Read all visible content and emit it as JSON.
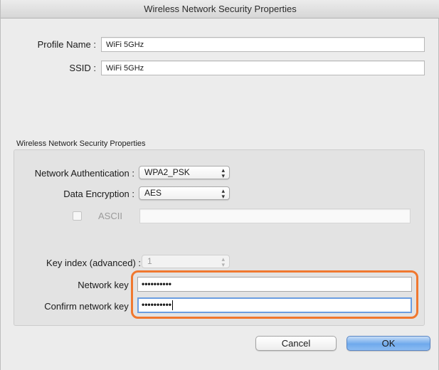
{
  "window": {
    "title": "Wireless Network Security Properties"
  },
  "profile": {
    "name_label": "Profile Name :",
    "name_value": "WiFi 5GHz",
    "ssid_label": "SSID :",
    "ssid_value": "WiFi 5GHz"
  },
  "security": {
    "group_title": "Wireless Network Security Properties",
    "auth_label": "Network Authentication :",
    "auth_value": "WPA2_PSK",
    "encryption_label": "Data Encryption :",
    "encryption_value": "AES",
    "ascii_label": "ASCII",
    "ascii_checked": false,
    "ascii_value": "",
    "key_index_label": "Key index (advanced) :",
    "key_index_value": "1",
    "network_key_label": "Network key :",
    "network_key_value": "••••••••••",
    "confirm_key_label": "Confirm network key :",
    "confirm_key_value": "••••••••••",
    "highlight_color": "#f0782f"
  },
  "buttons": {
    "cancel_label": "Cancel",
    "ok_label": "OK"
  },
  "icons": {
    "select_arrows": "up-down-chevron-icon"
  }
}
